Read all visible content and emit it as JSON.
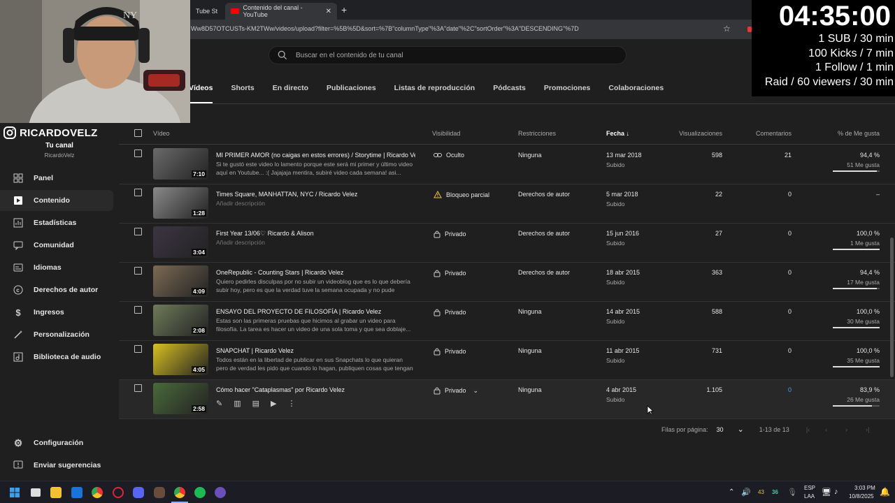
{
  "browser": {
    "tabs": [
      {
        "label": "Tube St"
      },
      {
        "label": "Contenido del canal - YouTube"
      }
    ],
    "url": "Ww8D57OTCUSTs-KM2TWw/videos/upload?filter=%5B%5D&sort=%7B\"columnType\"%3A\"date\"%2C\"sortOrder\"%3A\"DESCENDING\"%7D"
  },
  "search": {
    "placeholder": "Buscar en el contenido de tu canal"
  },
  "content_tabs": [
    "Vídeos",
    "Shorts",
    "En directo",
    "Publicaciones",
    "Listas de reproducción",
    "Pódcasts",
    "Promociones",
    "Colaboraciones"
  ],
  "overlay": {
    "logo_text": "RICARDOVELZ",
    "timer": "04:35:00",
    "lines": [
      "1 SUB / 30 min",
      "100 Kicks / 7 min",
      "1 Follow / 1 min",
      "Raid / 60 viewers / 30 min"
    ]
  },
  "channel": {
    "title": "Tu canal",
    "name": "RicardoVelz"
  },
  "sidebar": {
    "items": [
      {
        "label": "Panel",
        "icon": "dashboard-icon"
      },
      {
        "label": "Contenido",
        "icon": "content-icon"
      },
      {
        "label": "Estadísticas",
        "icon": "analytics-icon"
      },
      {
        "label": "Comunidad",
        "icon": "community-icon"
      },
      {
        "label": "Idiomas",
        "icon": "subtitles-icon"
      },
      {
        "label": "Derechos de autor",
        "icon": "copyright-icon"
      },
      {
        "label": "Ingresos",
        "icon": "dollar-icon"
      },
      {
        "label": "Personalización",
        "icon": "magic-wand-icon"
      },
      {
        "label": "Biblioteca de audio",
        "icon": "audio-library-icon"
      }
    ],
    "bottom": [
      {
        "label": "Configuración",
        "icon": "gear-icon"
      },
      {
        "label": "Enviar sugerencias",
        "icon": "feedback-icon"
      }
    ]
  },
  "table": {
    "headers": {
      "video": "Vídeo",
      "visibility": "Visibilidad",
      "restrictions": "Restricciones",
      "date": "Fecha",
      "views": "Visualizaciones",
      "comments": "Comentarios",
      "likes": "% de Me gusta"
    },
    "rows": [
      {
        "title": "MI PRIMER AMOR (no caigas en estos errores) / Storytime | Ricardo Vel...",
        "desc": "Si te gustó este video lo lamento porque este será mi primer y último video aquí en Youtube... :( Jajajaja mentira, subiré video cada semana! asi...",
        "duration": "7:10",
        "visibility": "Oculto",
        "vis_icon": "link-icon",
        "restrictions": "Ninguna",
        "date": "13 mar 2018",
        "date_sub": "Subido",
        "views": "598",
        "comments": "21",
        "pct": "94,4 %",
        "likes": "51 Me gusta",
        "like_ratio": 0.944,
        "thumb_color": "#6a6a6a"
      },
      {
        "title": "Times Square, MANHATTAN, NYC / Ricardo Velez",
        "desc": "Añadir descripción",
        "desc_empty": true,
        "duration": "1:28",
        "visibility": "Bloqueo parcial",
        "vis_icon": "warning-icon",
        "restrictions": "Derechos de autor",
        "date": "5 mar 2018",
        "date_sub": "Subido",
        "views": "22",
        "comments": "0",
        "pct": "–",
        "likes": "",
        "like_ratio": null,
        "thumb_color": "#8a8a8a"
      },
      {
        "title": "First Year 13/06♡ Ricardo & Alison",
        "desc": "Añadir descripción",
        "desc_empty": true,
        "duration": "3:04",
        "visibility": "Privado",
        "vis_icon": "lock-icon",
        "restrictions": "Derechos de autor",
        "date": "15 jun 2016",
        "date_sub": "Subido",
        "views": "27",
        "comments": "0",
        "pct": "100,0 %",
        "likes": "1 Me gusta",
        "like_ratio": 1.0,
        "thumb_color": "#3c3542"
      },
      {
        "title": "OneRepublic - Counting Stars | Ricardo Velez",
        "desc": "Quiero pedirles disculpas por no subir un videoblog que es lo que debería subir hoy, pero es que la verdad tuve la semana ocupada y no pude grabar....",
        "duration": "4:09",
        "visibility": "Privado",
        "vis_icon": "lock-icon",
        "restrictions": "Derechos de autor",
        "date": "18 abr 2015",
        "date_sub": "Subido",
        "views": "363",
        "comments": "0",
        "pct": "94,4 %",
        "likes": "17 Me gusta",
        "like_ratio": 0.944,
        "thumb_color": "#7b6a55"
      },
      {
        "title": "ENSAYO DEL PROYECTO DE FILOSOFÍA | Ricardo Velez",
        "desc": "Estas son las primeras pruebas que hicimos al grabar un video para filosofía. La tarea es hacer un video de una sola toma y que sea doblaje... Espero que...",
        "duration": "2:08",
        "visibility": "Privado",
        "vis_icon": "lock-icon",
        "restrictions": "Ninguna",
        "date": "14 abr 2015",
        "date_sub": "Subido",
        "views": "588",
        "comments": "0",
        "pct": "100,0 %",
        "likes": "30 Me gusta",
        "like_ratio": 1.0,
        "thumb_color": "#6f7b5a"
      },
      {
        "title": "SNAPCHAT | Ricardo Velez",
        "desc": "Todos están en la libertad de publicar en sus Snapchats lo que quieran pero de verdad les pido que cuando lo hagan, publiquen cosas que tengan sentid...",
        "duration": "4:05",
        "visibility": "Privado",
        "vis_icon": "lock-icon",
        "restrictions": "Ninguna",
        "date": "11 abr 2015",
        "date_sub": "Subido",
        "views": "731",
        "comments": "0",
        "pct": "100,0 %",
        "likes": "35 Me gusta",
        "like_ratio": 1.0,
        "thumb_color": "#d8c020"
      },
      {
        "title": "Cómo hacer \"Cataplasmas\" por Ricardo Velez",
        "desc": "",
        "duration": "2:58",
        "visibility": "Privado",
        "vis_icon": "lock-icon",
        "restrictions": "Ninguna",
        "date": "4 abr 2015",
        "date_sub": "Subido",
        "views": "1.105",
        "comments": "0",
        "pct": "83,9 %",
        "likes": "26 Me gusta",
        "like_ratio": 0.839,
        "thumb_color": "#4a6a3a",
        "hover": true
      }
    ]
  },
  "pagination": {
    "rows_label": "Filas por página:",
    "rows_value": "30",
    "range": "1-13 de 13"
  },
  "taskbar": {
    "lang1": "ESP",
    "lang2": "LAA",
    "time": "3:03 PM",
    "date": "10/8/2025",
    "badge1": "43",
    "badge2": "36"
  },
  "colors": {
    "accent": "#3ea6ff",
    "bg": "#1f1f1f"
  }
}
